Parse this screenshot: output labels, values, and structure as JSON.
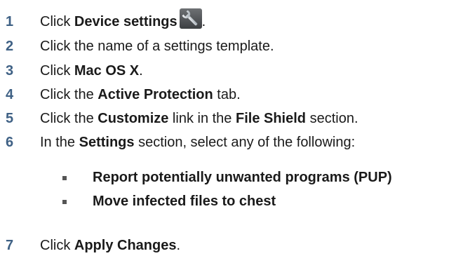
{
  "steps": [
    {
      "num": "1",
      "pre": "Click ",
      "bold": "Device settings",
      "post": "."
    },
    {
      "num": "2",
      "text": "Click the name of a settings template."
    },
    {
      "num": "3",
      "pre": "Click ",
      "bold": "Mac OS X",
      "post": "."
    },
    {
      "num": "4",
      "pre": "Click the ",
      "bold": "Active Protection",
      "post": " tab."
    },
    {
      "num": "5",
      "pre": "Click the ",
      "bold": "Customize",
      "mid": " link in the ",
      "bold2": "File Shield",
      "post": " section."
    },
    {
      "num": "6",
      "pre": "In the ",
      "bold": "Settings",
      "post": " section, select any of the following:"
    },
    {
      "num": "7",
      "pre": "Click ",
      "bold": "Apply Changes",
      "post": "."
    }
  ],
  "options": [
    "Report potentially unwanted programs (PUP)",
    "Move infected files to chest"
  ],
  "icons": {
    "device_settings": "wrench-icon"
  }
}
